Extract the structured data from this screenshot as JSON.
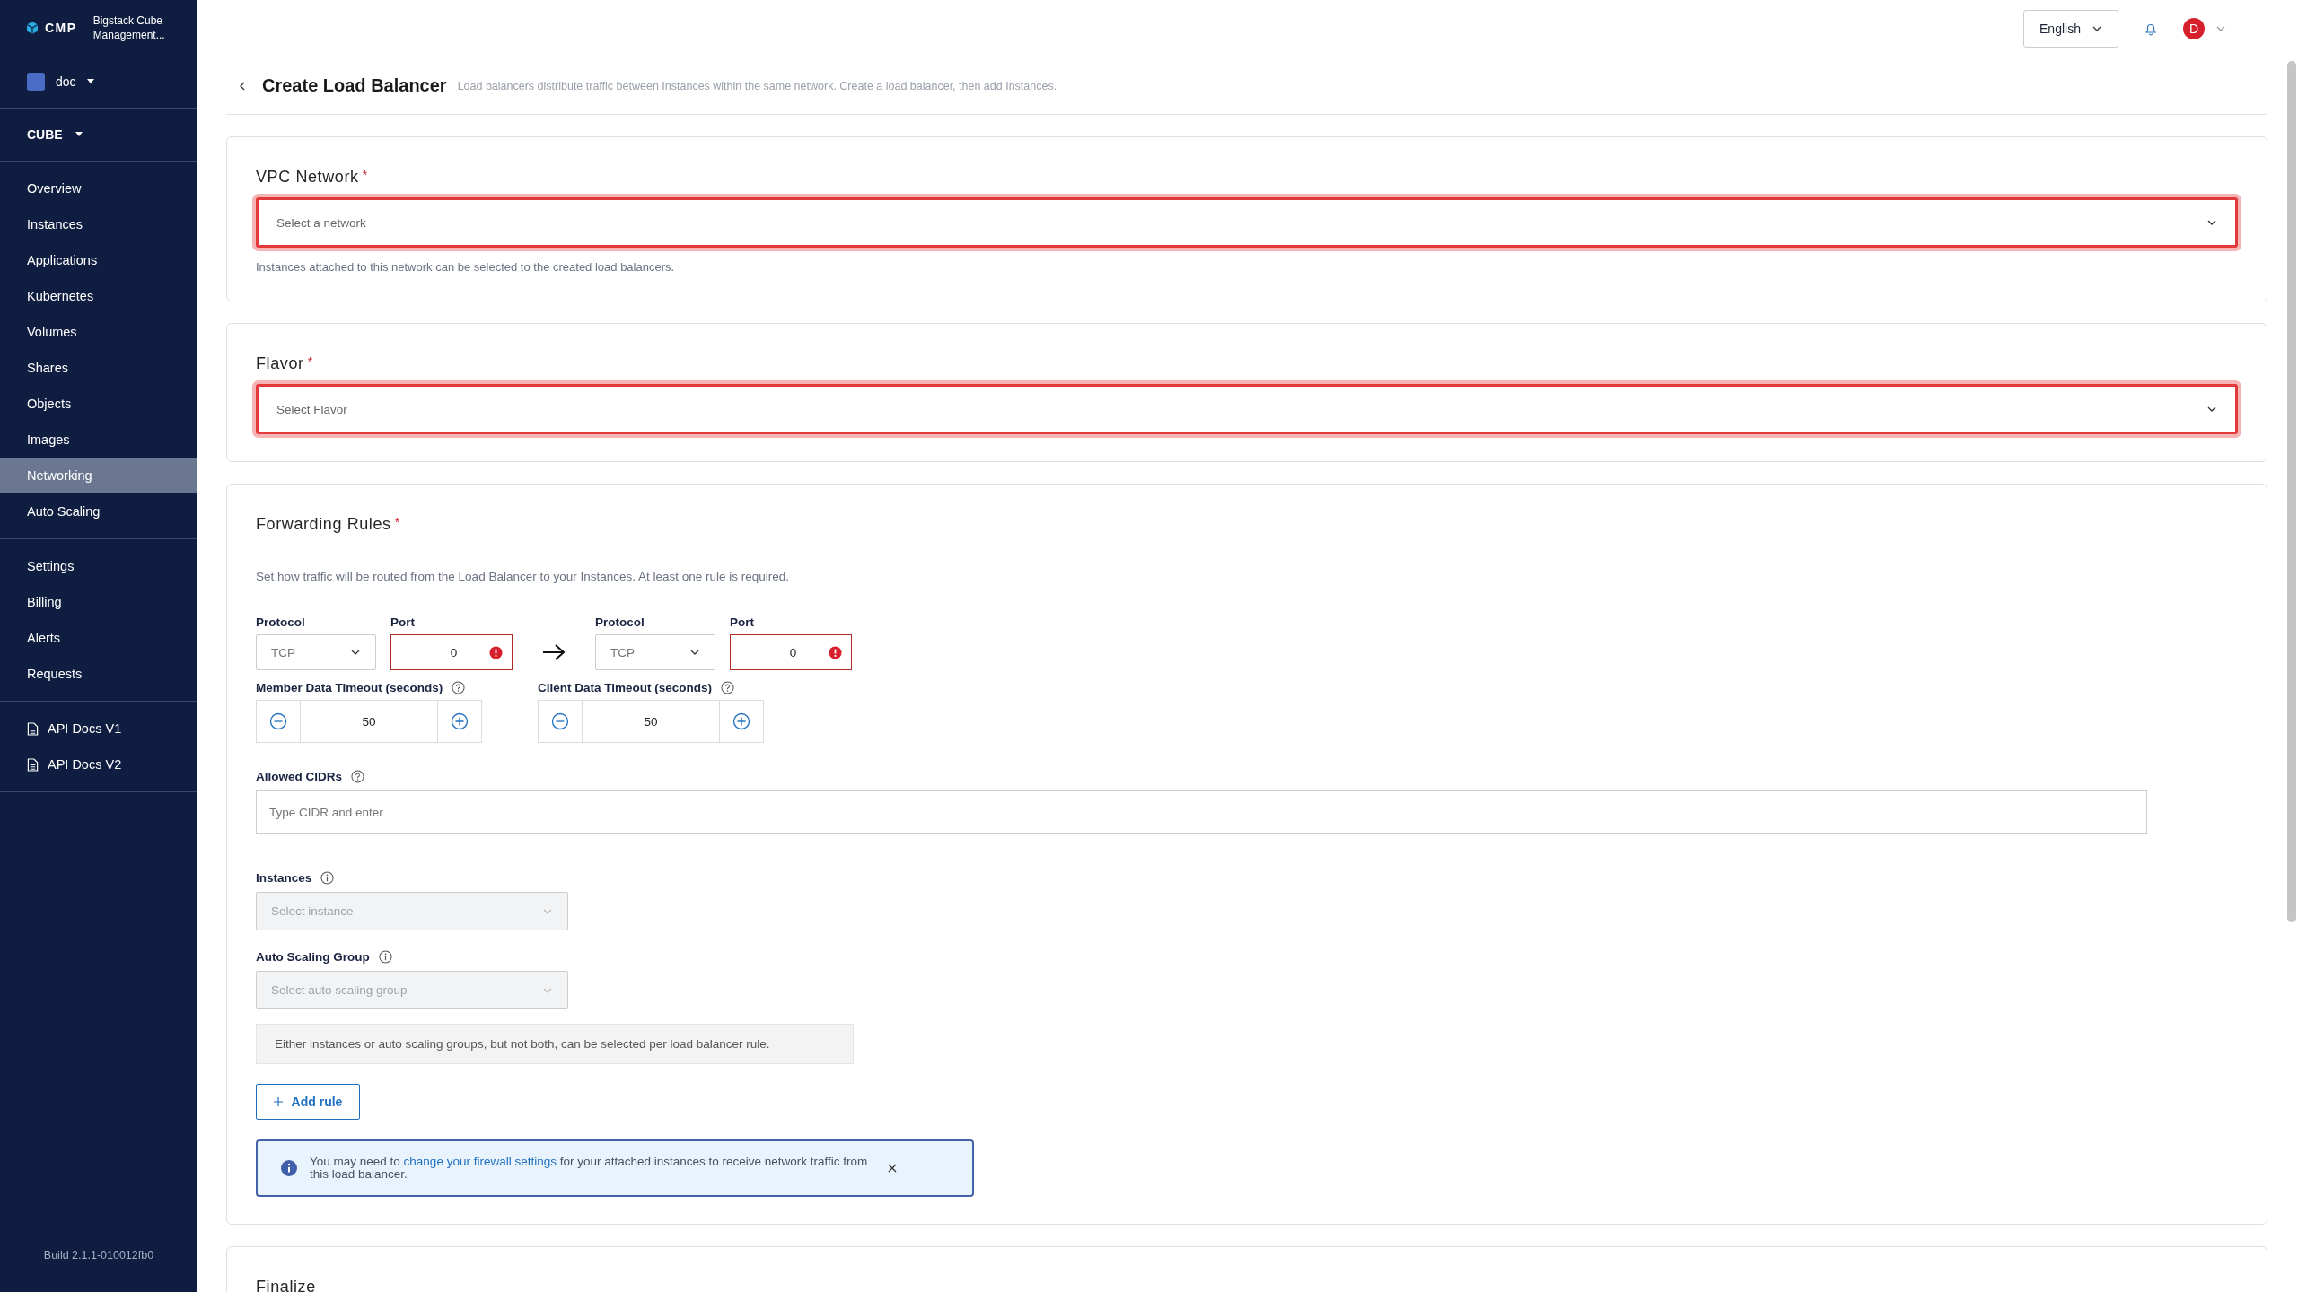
{
  "brand": {
    "logo": "CMP",
    "product": "Bigstack Cube Management..."
  },
  "project": {
    "name": "doc",
    "color": "#4a6cc4"
  },
  "region": "CUBE",
  "nav_groups": [
    [
      {
        "label": "Overview",
        "selected": false
      },
      {
        "label": "Instances",
        "selected": false
      },
      {
        "label": "Applications",
        "selected": false
      },
      {
        "label": "Kubernetes",
        "selected": false
      },
      {
        "label": "Volumes",
        "selected": false
      },
      {
        "label": "Shares",
        "selected": false
      },
      {
        "label": "Objects",
        "selected": false
      },
      {
        "label": "Images",
        "selected": false
      },
      {
        "label": "Networking",
        "selected": true
      },
      {
        "label": "Auto Scaling",
        "selected": false
      }
    ],
    [
      {
        "label": "Settings",
        "selected": false
      },
      {
        "label": "Billing",
        "selected": false
      },
      {
        "label": "Alerts",
        "selected": false
      },
      {
        "label": "Requests",
        "selected": false
      }
    ],
    [
      {
        "label": "API Docs V1",
        "selected": false,
        "kind": "doc"
      },
      {
        "label": "API Docs V2",
        "selected": false,
        "kind": "doc"
      }
    ]
  ],
  "build": "Build 2.1.1-010012fb0",
  "header": {
    "language": "English",
    "avatar": "D"
  },
  "page": {
    "title": "Create Load Balancer",
    "description": "Load balancers distribute traffic between Instances within the same network. Create a load balancer, then add Instances."
  },
  "vpc": {
    "title": "VPC Network",
    "required_mark": "*",
    "select": {
      "placeholder": "Select a network",
      "invalid": true
    },
    "help": "Instances attached to this network can be selected to the created load balancers."
  },
  "flavor": {
    "title": "Flavor",
    "required_mark": "*",
    "select": {
      "placeholder": "Select Flavor",
      "invalid": true
    }
  },
  "forwarding": {
    "title": "Forwarding Rules",
    "required_mark": "*",
    "description": "Set how traffic will be routed from the Load Balancer to your Instances. At least one rule is required.",
    "sides": [
      {
        "protocol_label": "Protocol",
        "protocol": "TCP",
        "port_label": "Port",
        "port": "0",
        "port_invalid": true
      },
      {
        "protocol_label": "Protocol",
        "protocol": "TCP",
        "port_label": "Port",
        "port": "0",
        "port_invalid": true
      }
    ],
    "timeouts": [
      {
        "label": "Member Data Timeout (seconds)",
        "value": "50"
      },
      {
        "label": "Client Data Timeout (seconds)",
        "value": "50"
      }
    ],
    "cidrs": {
      "label": "Allowed CIDRs",
      "placeholder": "Type CIDR and enter"
    },
    "instances": {
      "label": "Instances",
      "placeholder": "Select instance",
      "disabled": true
    },
    "asg": {
      "label": "Auto Scaling Group",
      "placeholder": "Select auto scaling group",
      "disabled": true
    },
    "note": "Either instances or auto scaling groups, but not both, can be selected per load balancer rule.",
    "add_rule": "Add rule",
    "notice": {
      "before": "You may need to",
      "link": "change your firewall settings",
      "after": "for your attached instances to receive network traffic from this load balancer."
    }
  },
  "finalize": {
    "title": "Finalize"
  }
}
